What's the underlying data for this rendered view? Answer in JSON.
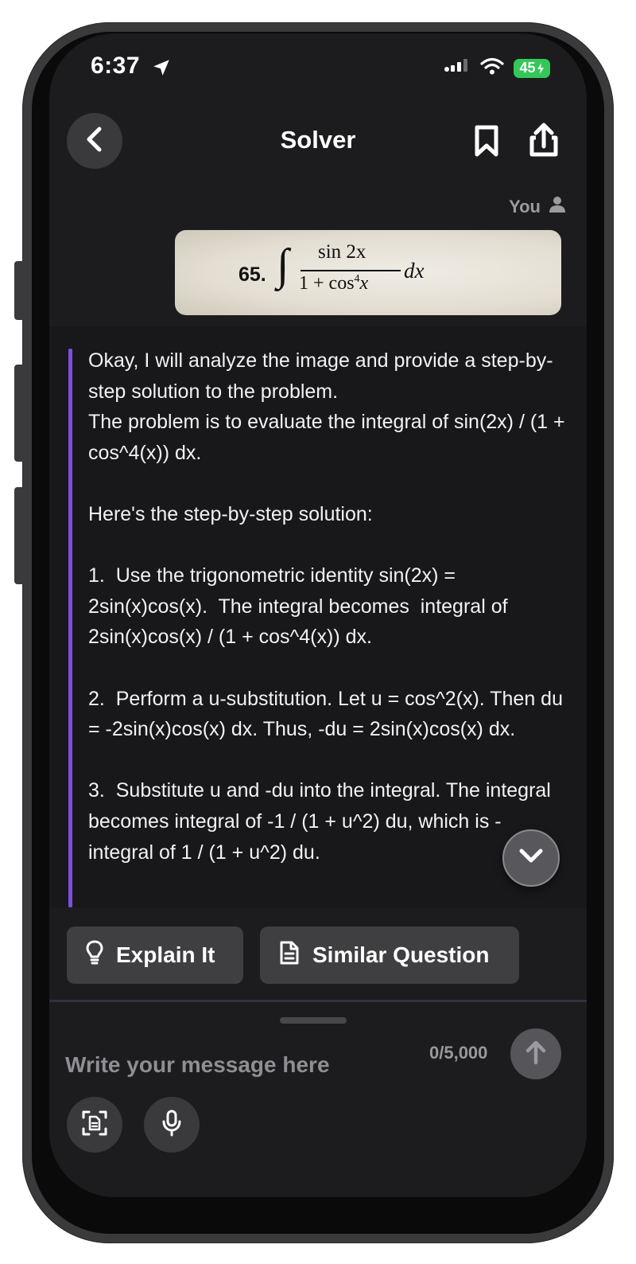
{
  "status_bar": {
    "time": "6:37",
    "battery": "45"
  },
  "header": {
    "title": "Solver"
  },
  "user_message": {
    "sender_label": "You",
    "image": {
      "problem_number": "65.",
      "integral_sign": "∫",
      "numerator": "sin 2x",
      "denominator_prefix": "1 + cos",
      "denominator_exponent": "4",
      "denominator_var": "x",
      "differential": "dx"
    }
  },
  "answer": {
    "text": "Okay, I will analyze the image and provide a step-by-step solution to the problem.\nThe problem is to evaluate the integral of sin(2x) / (1 + cos^4(x)) dx.\n\nHere's the step-by-step solution:\n\n1.  Use the trigonometric identity sin(2x) = 2sin(x)cos(x).  The integral becomes  integral of 2sin(x)cos(x) / (1 + cos^4(x)) dx.\n\n2.  Perform a u-substitution. Let u = cos^2(x). Then du = -2sin(x)cos(x) dx. Thus, -du = 2sin(x)cos(x) dx.\n\n3.  Substitute u and -du into the integral. The integral becomes integral of -1 / (1 + u^2) du, which is - integral of 1 / (1 + u^2) du.",
    "accent_color": "#7b4fe0"
  },
  "actions": {
    "explain_label": "Explain It",
    "similar_label": "Similar Question"
  },
  "composer": {
    "placeholder": "Write your message here",
    "value": "",
    "char_count": "0/5,000"
  },
  "icons": {
    "location": "location-arrow-icon",
    "signal": "signal-icon",
    "wifi": "wifi-icon",
    "back": "chevron-left-icon",
    "bookmark": "bookmark-icon",
    "share": "share-icon",
    "user": "user-icon",
    "scroll": "chevron-down-icon",
    "explain": "lightbulb-icon",
    "similar": "document-icon",
    "send": "arrow-up-icon",
    "scan": "scan-document-icon",
    "mic": "microphone-icon"
  }
}
